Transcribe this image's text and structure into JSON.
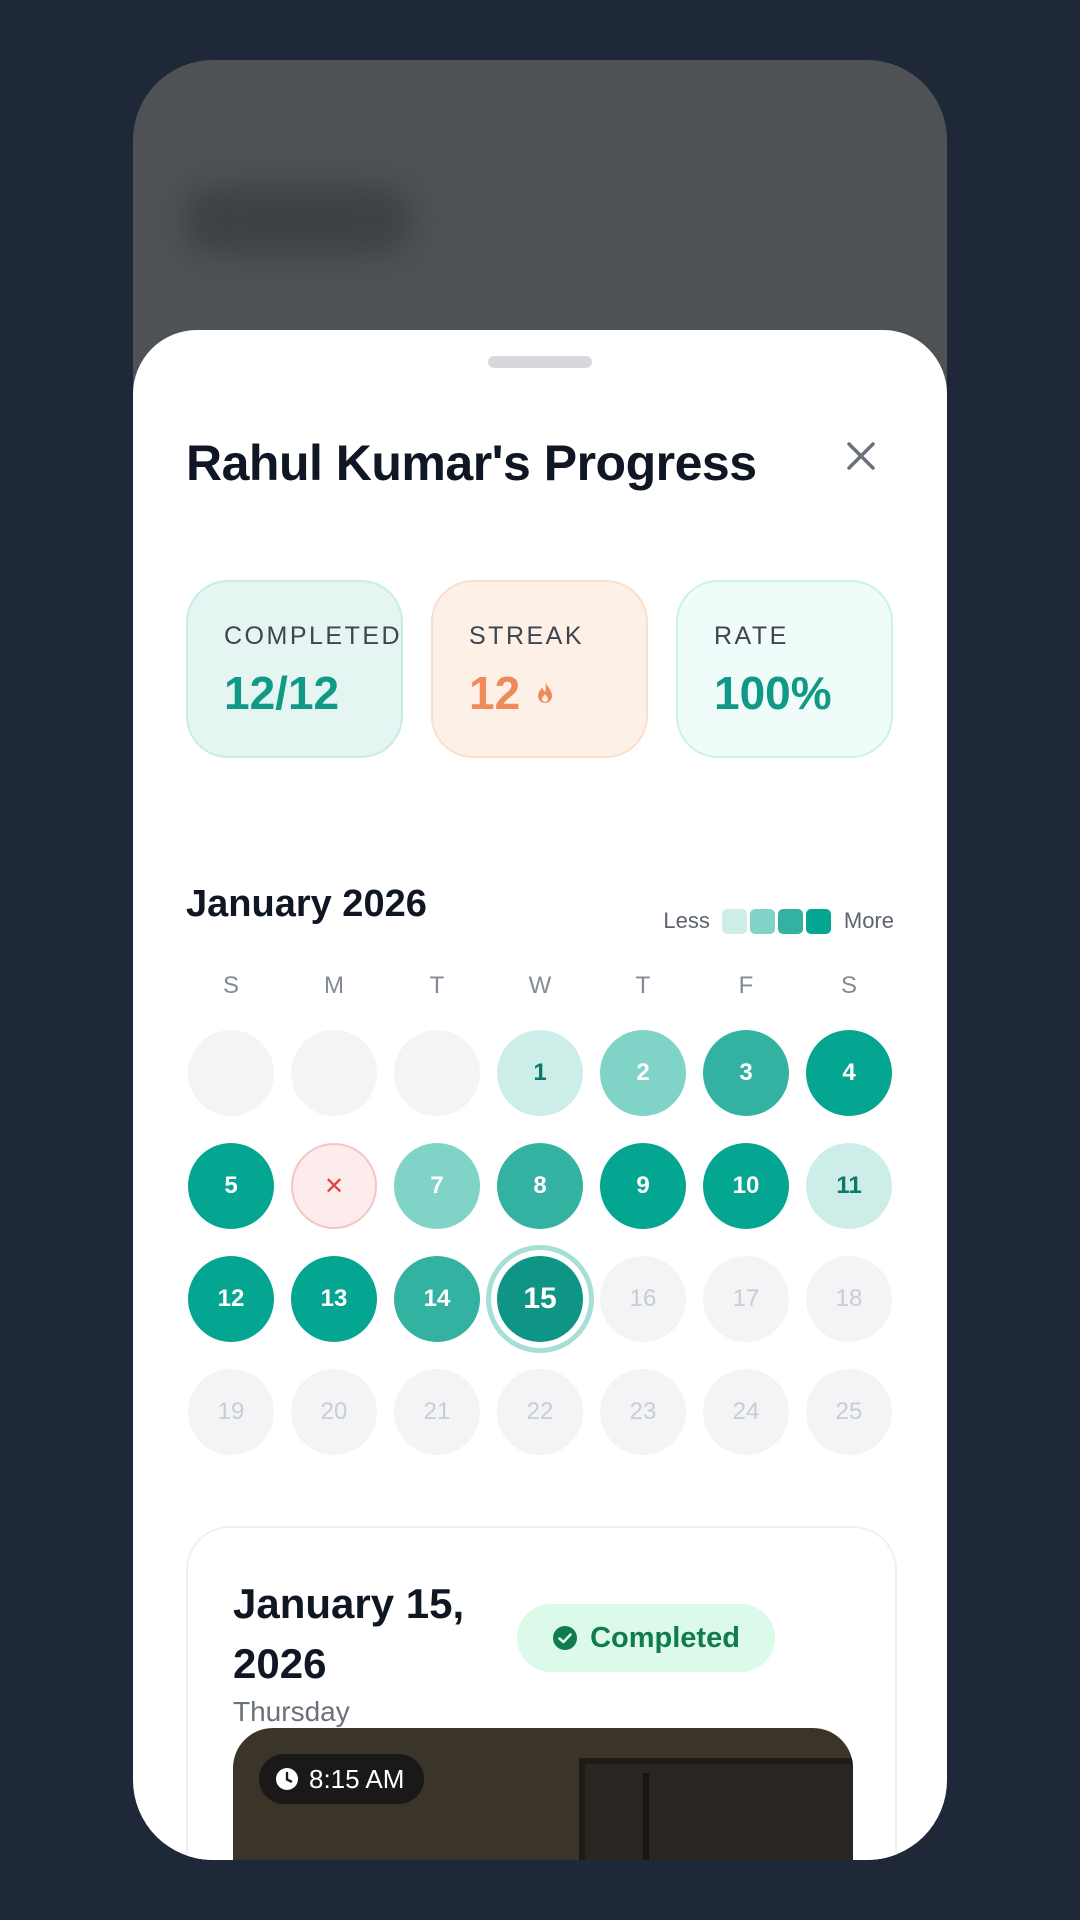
{
  "sheet": {
    "title": "Rahul Kumar's Progress"
  },
  "stats": {
    "completed_label": "COMPLETED",
    "completed_value": "12/12",
    "streak_label": "STREAK",
    "streak_value": "12",
    "rate_label": "RATE",
    "rate_value": "100%"
  },
  "calendar": {
    "month": "January 2026",
    "legend_less": "Less",
    "legend_more": "More",
    "weekdays": [
      "S",
      "M",
      "T",
      "W",
      "T",
      "F",
      "S"
    ],
    "days": [
      {
        "label": "",
        "state": "empty"
      },
      {
        "label": "",
        "state": "empty"
      },
      {
        "label": "",
        "state": "empty"
      },
      {
        "label": "1",
        "state": "level-1"
      },
      {
        "label": "2",
        "state": "level-2"
      },
      {
        "label": "3",
        "state": "level-3"
      },
      {
        "label": "4",
        "state": "level-4"
      },
      {
        "label": "5",
        "state": "level-4"
      },
      {
        "label": "✕",
        "state": "missed"
      },
      {
        "label": "7",
        "state": "level-2"
      },
      {
        "label": "8",
        "state": "level-3"
      },
      {
        "label": "9",
        "state": "level-4"
      },
      {
        "label": "10",
        "state": "level-4"
      },
      {
        "label": "11",
        "state": "level-1"
      },
      {
        "label": "12",
        "state": "level-4"
      },
      {
        "label": "13",
        "state": "level-4"
      },
      {
        "label": "14",
        "state": "level-3"
      },
      {
        "label": "15",
        "state": "today"
      },
      {
        "label": "16",
        "state": "future"
      },
      {
        "label": "17",
        "state": "future"
      },
      {
        "label": "18",
        "state": "future"
      },
      {
        "label": "19",
        "state": "future"
      },
      {
        "label": "20",
        "state": "future"
      },
      {
        "label": "21",
        "state": "future"
      },
      {
        "label": "22",
        "state": "future"
      },
      {
        "label": "23",
        "state": "future"
      },
      {
        "label": "24",
        "state": "future"
      },
      {
        "label": "25",
        "state": "future"
      }
    ]
  },
  "detail": {
    "date": "January 15, 2026",
    "weekday": "Thursday",
    "status": "Completed",
    "time": "8:15 AM"
  },
  "colors": {
    "accent": "#04a591",
    "streak": "#ef8a5a",
    "missed": "#e0443e",
    "completed_badge": "#107c4b"
  }
}
